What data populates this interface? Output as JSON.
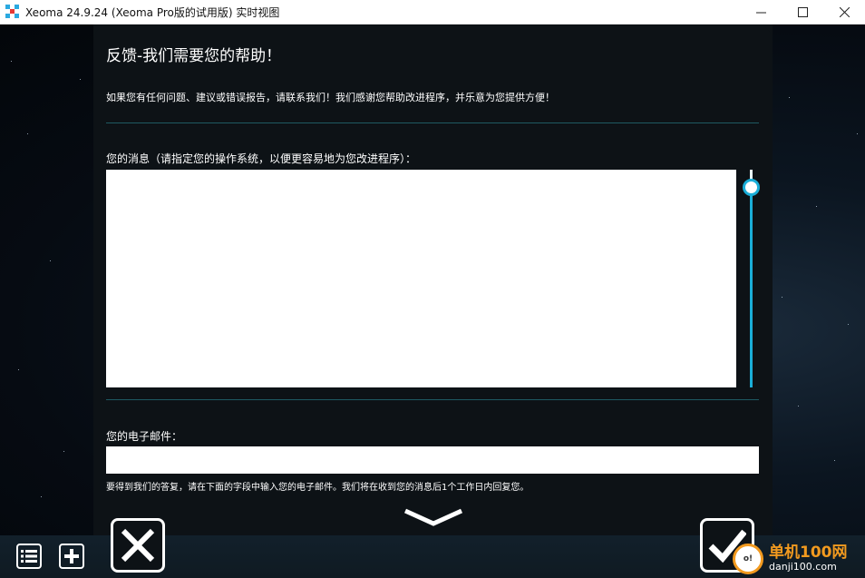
{
  "window": {
    "title": "Xeoma 24.9.24 (Xeoma Pro版的试用版) 实时视图",
    "controls": [
      "minimize",
      "maximize",
      "close"
    ]
  },
  "dialog": {
    "heading": "反馈-我们需要您的帮助！",
    "intro": "如果您有任何问题、建议或错误报告，请联系我们！我们感谢您帮助改进程序，并乐意为您提供方便！",
    "message_label": "您的消息（请指定您的操作系统，以便更容易地为您改进程序）：",
    "message_value": "",
    "email_label": "您的电子邮件：",
    "email_value": "",
    "email_hint": "要得到我们的答复，请在下面的字段中输入您的电子邮件。我们将在收到您的消息后1个工作日内回复您。"
  },
  "colors": {
    "accent": "#1aaed8",
    "divider": "#1e5a62",
    "panel": "#0d1216",
    "watermark_orange": "#f29a1f"
  },
  "icons": {
    "list": "list-icon",
    "add": "plus-icon",
    "cancel": "close-x-icon",
    "confirm": "checkmark-icon",
    "more": "chevron-down-icon"
  },
  "watermark": {
    "title": "单机100网",
    "url": "danji100.com",
    "logo_text": "o!"
  }
}
